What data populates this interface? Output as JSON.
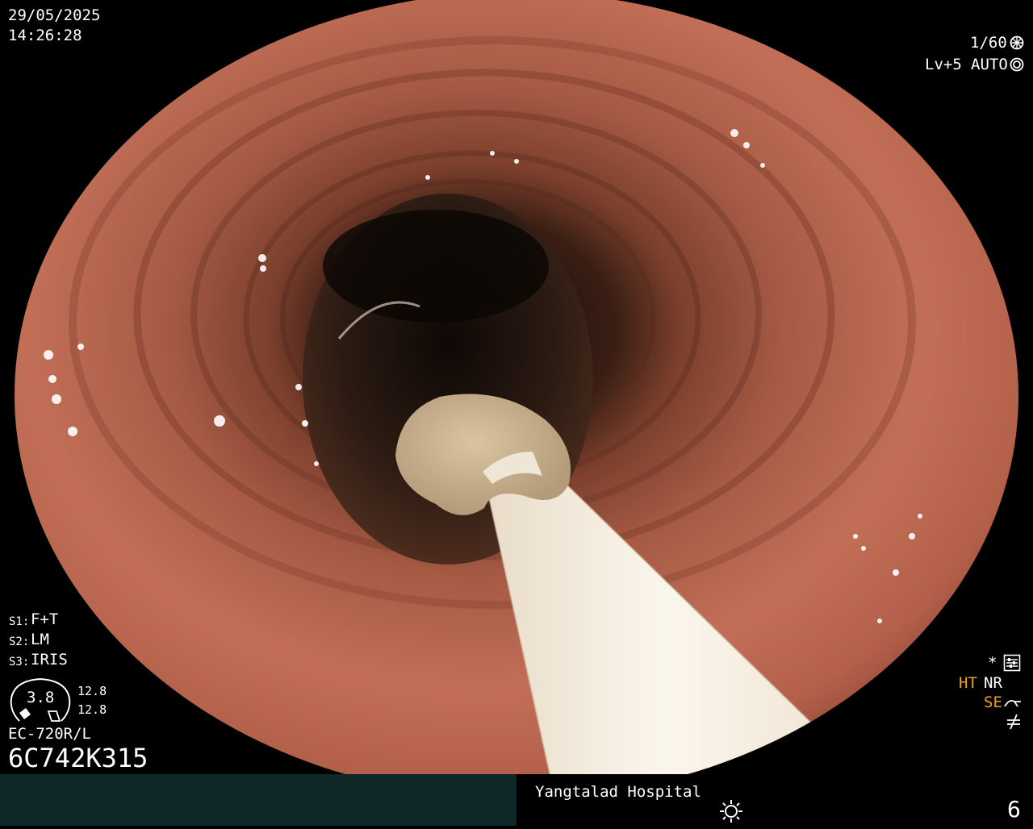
{
  "overlay": {
    "date": "29/05/2025",
    "time": "14:26:28",
    "shutter": "1/60",
    "level": "Lv+5",
    "exposure": "AUTO",
    "s1_key": "S1:",
    "s1_val": "F+T",
    "s2_key": "S2:",
    "s2_val": "LM",
    "s3_key": "S3:",
    "s3_val": "IRIS",
    "gauge_value": "3.8",
    "gauge_right_top": "12.8",
    "gauge_right_bottom": "12.8",
    "scope_model": "EC-720R/L",
    "scope_serial": "6C742K315",
    "ht": "HT",
    "nr": "NR",
    "se": "SE",
    "star": "*"
  },
  "footer": {
    "hospital": "Yangtalad Hospital",
    "page_number": "6"
  },
  "icons": {
    "shutter": "aperture-icon",
    "auto": "auto-iris-icon",
    "menu": "settings-panel-icon",
    "se": "enhancement-curve-icon",
    "filter": "filter-slash-icon",
    "light": "brightness-sun-icon"
  },
  "colors": {
    "mucosa": "#b9644f",
    "lumen": "#1c100c",
    "accent": "#f0a020",
    "footer_bar": "#102727"
  }
}
